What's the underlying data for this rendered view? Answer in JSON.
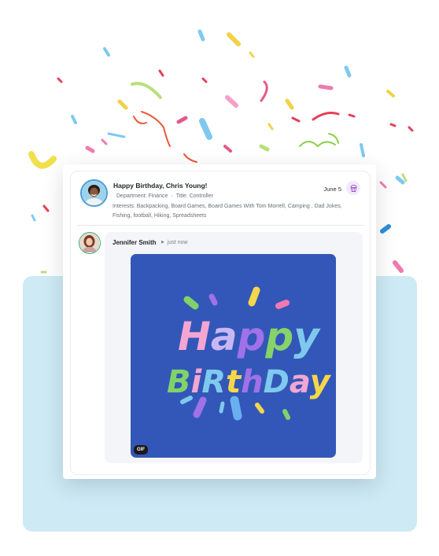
{
  "post": {
    "title": "Happy Birthday, Chris Young!",
    "department": "Department: Finance",
    "role": "Title: Controller",
    "interests": "Interests: Backpacking, Board Games, Board Games With Tom Morrell, Camping , Dad Jokes, Fishing, football, Hiking, Spreadsheets",
    "date": "June 5",
    "badge_icon": "cupcake-icon"
  },
  "reply": {
    "author": "Jennifer Smith",
    "time": "just now",
    "gif_badge": "GIF",
    "gif_text_line1": "Happy",
    "gif_text_line2": "Birthday"
  },
  "colors": {
    "panel_bg": "#cdeaf5",
    "gif_bg": "#3357b8",
    "badge_bg": "#f3e9fb"
  }
}
